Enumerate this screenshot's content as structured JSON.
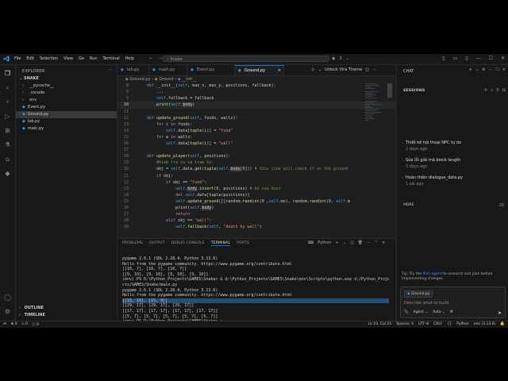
{
  "titlebar": {
    "menu": [
      "File",
      "Edit",
      "Selection",
      "View",
      "Go",
      "Run",
      "Terminal",
      "Help"
    ],
    "search_text": "Snake",
    "badge": "3"
  },
  "explorer": {
    "title": "EXPLORER",
    "root": "SNAKE",
    "items": [
      {
        "label": "__pycache__",
        "kind": "folder",
        "selected": false
      },
      {
        "label": ".vscode",
        "kind": "folder",
        "selected": false
      },
      {
        "label": "env",
        "kind": "folder",
        "selected": false
      },
      {
        "label": "Event.py",
        "kind": "py",
        "selected": false
      },
      {
        "label": "Ground.py",
        "kind": "py",
        "selected": true
      },
      {
        "label": "lab.py",
        "kind": "py",
        "selected": false
      },
      {
        "label": "main.py",
        "kind": "py",
        "selected": false
      }
    ],
    "outline": "OUTLINE",
    "timeline": "TIMELINE"
  },
  "tabs": [
    {
      "label": "lab.py",
      "active": false
    },
    {
      "label": "main.py",
      "active": false
    },
    {
      "label": "Event.py",
      "active": false
    },
    {
      "label": "Ground.py",
      "active": true
    }
  ],
  "editor_actions": {
    "theme": "Unlock Vira Theme"
  },
  "breadcrumb": {
    "file": "Ground.py",
    "cls": "Ground",
    "method": "__init__"
  },
  "code_lines": [
    {
      "n": "7",
      "text": "class Ground():"
    },
    {
      "n": "8",
      "text": "    def __init__(self, max_x, max_y, positions, fallback):"
    },
    {
      "n": "9",
      "text": "        ..."
    },
    {
      "n": "9",
      "text": "        self.fallback = fallback"
    },
    {
      "n": "10",
      "text": "        print(self.body)"
    },
    {
      "n": "11",
      "text": ""
    },
    {
      "n": "12",
      "text": "    def update_ground(self, foods, walls):"
    },
    {
      "n": "13",
      "text": "        for i in foods:"
    },
    {
      "n": "14",
      "text": "            self.data[tuple(i)] = \"food\""
    },
    {
      "n": "15",
      "text": "        for w in walls:"
    },
    {
      "n": "16",
      "text": "            self.data[tuple(i)] = \"wall\""
    },
    {
      "n": "17",
      "text": ""
    },
    {
      "n": "18",
      "text": "    def update_player(self, positions):"
    },
    {
      "n": "19",
      "text": "        #kiem tra co va tram ko:"
    },
    {
      "n": "20",
      "text": "        obj = self.data.get(tuple(self.body[0])) # this line will check if on the ground"
    },
    {
      "n": "21",
      "text": "        if obj:"
    },
    {
      "n": "22",
      "text": "            if obj == \"food\":"
    },
    {
      "n": "23",
      "text": "                self.body.insert(0, positions) # ko xoa duoi"
    },
    {
      "n": "24",
      "text": "                del self.data[tuple(positions)]"
    },
    {
      "n": "25",
      "text": "                self.update_ground([[random.randint(0 ,self.mx), random.randint(0, self.m"
    },
    {
      "n": "26",
      "text": "                print(self.body)"
    },
    {
      "n": "27",
      "text": "                return"
    },
    {
      "n": "28",
      "text": "            elif obj == \"wall\":"
    },
    {
      "n": "29",
      "text": "                self.fallback(self, \"death by wall\")"
    }
  ],
  "panel": {
    "tabs": [
      "PROBLEMS",
      "OUTPUT",
      "DEBUG CONSOLE",
      "TERMINAL",
      "PORTS"
    ],
    "active_tab": "TERMINAL",
    "shell": "Python"
  },
  "terminal_lines": [
    {
      "text": "pygame 2.6.1 (SDL 2.28.4, Python 3.13.6)",
      "sel": false
    },
    {
      "text": "Hello from the pygame community. https://www.pygame.org/contribute.html",
      "sel": false
    },
    {
      "text": "[[10, 7], [10, 7], [10, 7]]",
      "sel": false
    },
    {
      "text": "[[9, 10], [9, 10], [9, 10], [9, 10]]",
      "sel": false
    },
    {
      "text": "(env) PS D:\\Python_Projects\\GAMES\\Snake> & d:\\Python_Projects\\GAMES\\Snake\\env\\Scripts\\python.exe d:/Python_Proje",
      "sel": false
    },
    {
      "text": "cts/GAMES/Snake/main.py",
      "sel": false
    },
    {
      "text": "pygame 2.6.1 (SDL 2.28.4, Python 3.13.6)",
      "sel": false
    },
    {
      "text": "Hello from the pygame community. https://www.pygame.org/contribute.html",
      "sel": false
    },
    {
      "text": "[[15, 10], [15, 9]]",
      "sel": true
    },
    {
      "text": "[[29, 17], [29, 17], [29, 17]]",
      "sel": false
    },
    {
      "text": "[[17, 17], [17, 17], [17, 17], [17, 17]]",
      "sel": false
    },
    {
      "text": "[[5, 7], [5, 7], [5, 7], [5, 7], [5, 7]]",
      "sel": false
    },
    {
      "text": "(env) PS D:\\Python_Projects\\GAMES\\Snake> ",
      "sel": false
    }
  ],
  "chat": {
    "title": "CHAT",
    "sessions_title": "SESSIONS",
    "sessions": [
      {
        "title": "Thiết kế hội thoại NPC tự do",
        "date": "2 days ago"
      },
      {
        "title": "Sửa lỗi giải mã block length",
        "date": "3 days ago"
      },
      {
        "title": "Hoàn thiện dialogue_data.py",
        "date": "1 wk ago"
      }
    ],
    "more_label": "MORE",
    "more_count": "28",
    "tip_prefix": "Tip: Try the",
    "tip_link": "Plan agent",
    "tip_suffix": "to research and plan before implementing changes.",
    "attachment": "Ground.py",
    "placeholder": "Describe what to build",
    "agent": "Agent",
    "auto": "Auto",
    "local": "Local",
    "approvals": "Default Approvals"
  },
  "status": {
    "errors": "0",
    "warnings": "0",
    "infos": "0",
    "position": "Ln 10, Col 24",
    "spaces": "Spaces: 4",
    "encoding": "UTF-8",
    "eol": "CRLF",
    "braces": "{}",
    "language": "Python",
    "interpreter": "env (3.13.6)"
  }
}
